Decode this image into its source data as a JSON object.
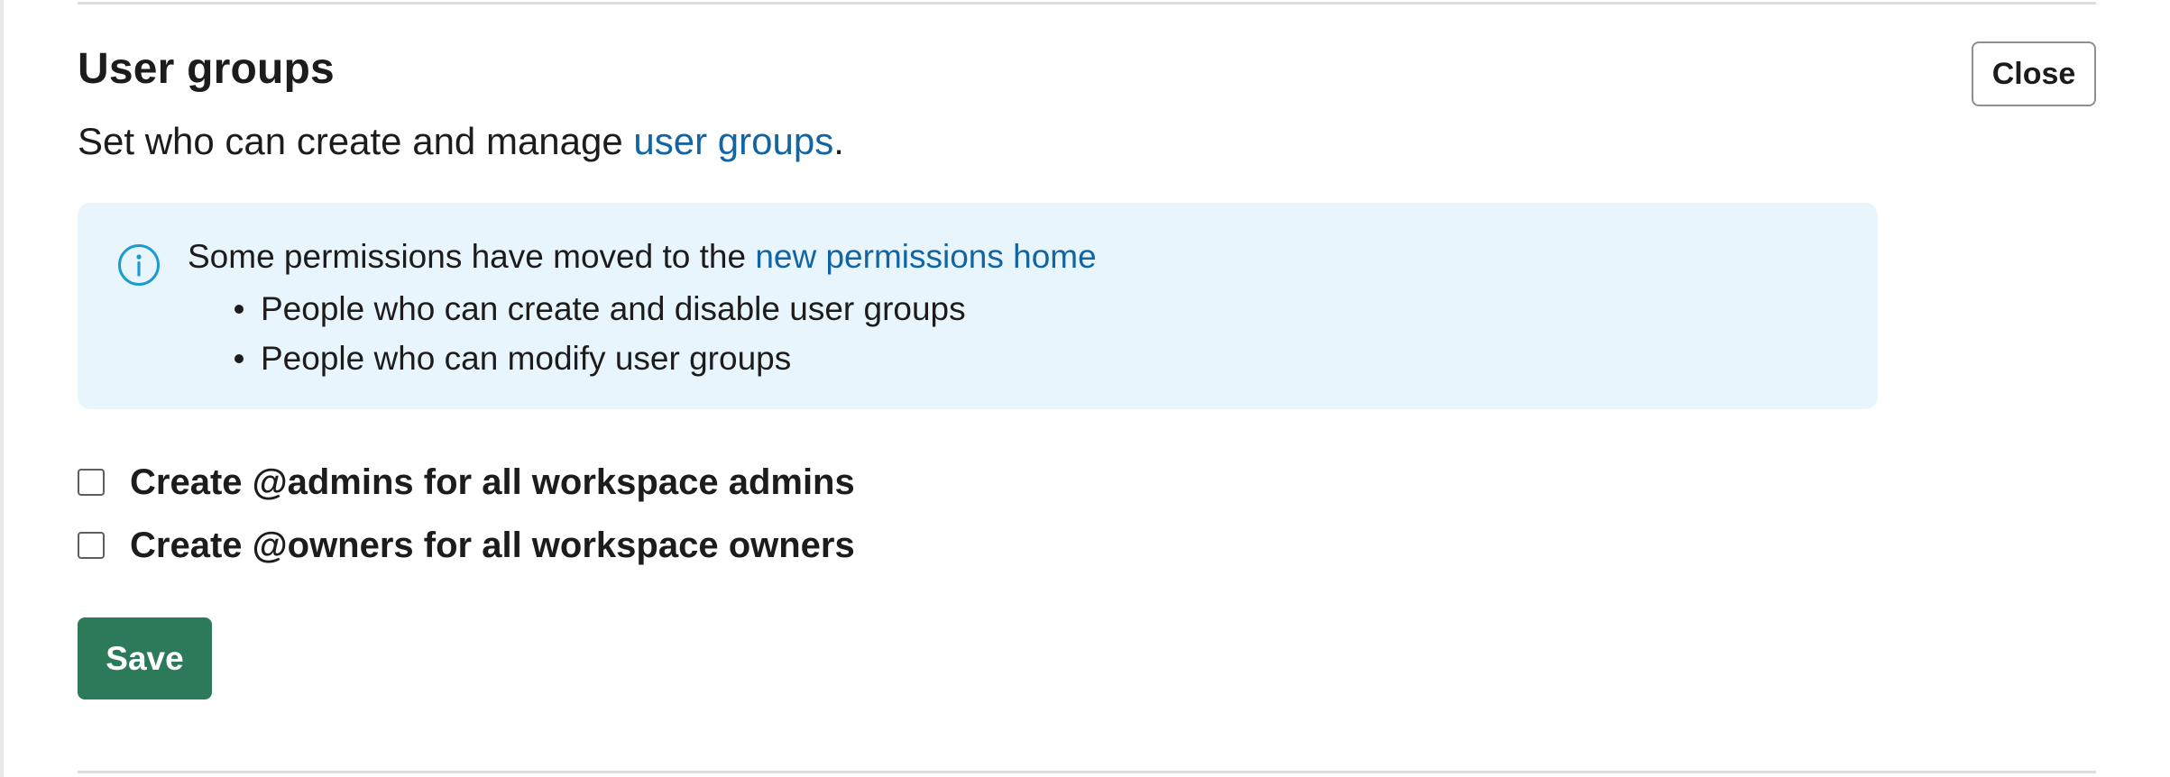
{
  "section": {
    "title": "User groups",
    "close_label": "Close",
    "description_prefix": "Set who can create and manage ",
    "description_link": "user groups",
    "description_suffix": "."
  },
  "info": {
    "icon": "info-icon",
    "heading_prefix": "Some permissions have moved to the ",
    "heading_link": "new permissions home",
    "items": [
      "People who can create and disable user groups",
      "People who can modify user groups"
    ]
  },
  "options": [
    {
      "label": "Create @admins for all workspace admins",
      "checked": false
    },
    {
      "label": "Create @owners for all workspace owners",
      "checked": false
    }
  ],
  "actions": {
    "save_label": "Save"
  },
  "colors": {
    "link": "#1264a3",
    "info_background": "#e8f5fc",
    "info_icon": "#1d9bd1",
    "primary_button": "#2d7a5b",
    "text": "#1d1c1d"
  }
}
